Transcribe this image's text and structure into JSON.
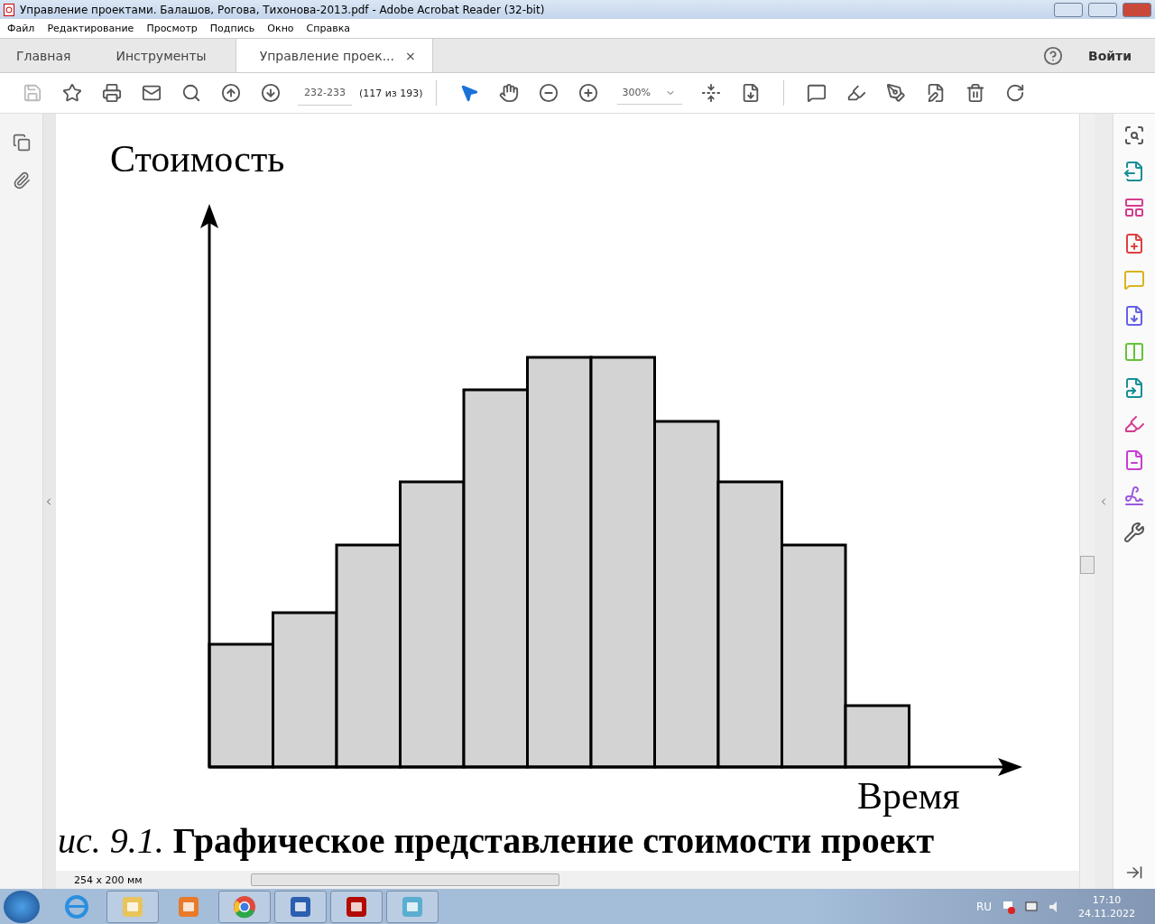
{
  "window": {
    "title": "Управление проектами. Балашов, Рогова, Тихонова-2013.pdf - Adobe Acrobat Reader (32-bit)"
  },
  "menu": [
    "Файл",
    "Редактирование",
    "Просмотр",
    "Подпись",
    "Окно",
    "Справка"
  ],
  "tabs": [
    {
      "label": "Главная",
      "selected": false
    },
    {
      "label": "Инструменты",
      "selected": false
    },
    {
      "label": "Управление проек...",
      "selected": true
    }
  ],
  "close_tab": "×",
  "sign_in": "Войти",
  "toolbar": {
    "page_field": "232-233",
    "page_count": "(117 из 193)",
    "zoom": "300%"
  },
  "document": {
    "y_label": "Стоимость",
    "x_label": "Время",
    "caption": "*ис. 9.1.* **Графическое представление стоимости проект**"
  },
  "status": {
    "page_size": "254 x 200 мм"
  },
  "taskbar": {
    "language": "RU",
    "time": "17:10",
    "date": "24.11.2022"
  }
}
